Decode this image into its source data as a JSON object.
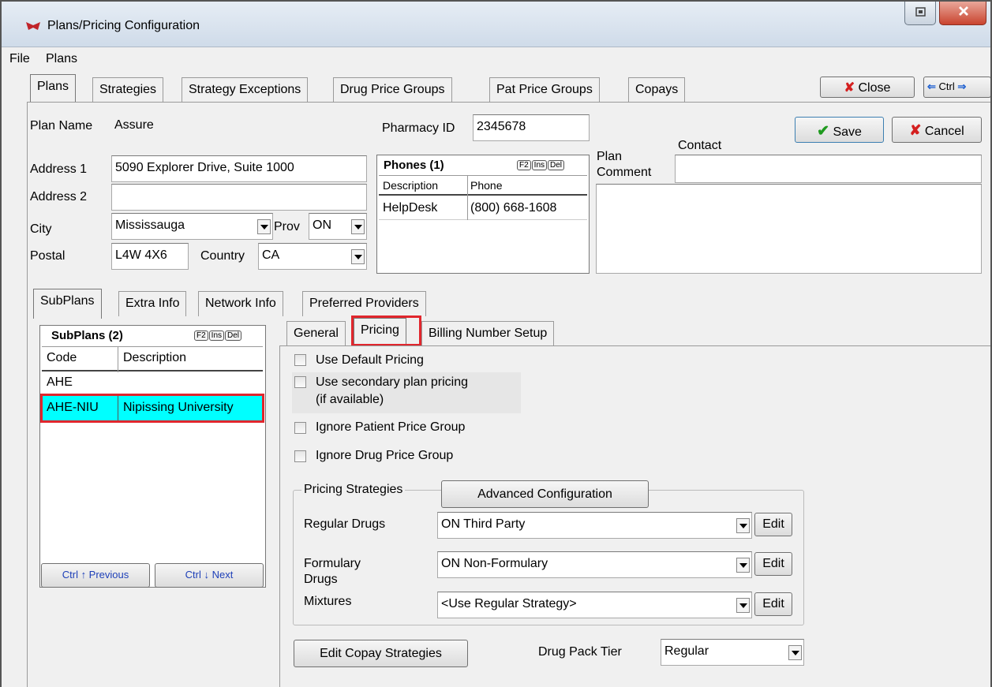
{
  "window": {
    "title": "Plans/Pricing Configuration"
  },
  "menu": [
    "File",
    "Plans"
  ],
  "main_tabs": [
    "Plans",
    "Strategies",
    "Strategy Exceptions",
    "Drug Price Groups",
    "Pat Price Groups",
    "Copays"
  ],
  "toolbar": {
    "close_label": "Close",
    "ctrl_label": "Ctrl"
  },
  "actions": {
    "save_label": "Save",
    "cancel_label": "Cancel"
  },
  "plan": {
    "name_label": "Plan Name",
    "name": "Assure",
    "pharmacy_id_label": "Pharmacy ID",
    "pharmacy_id": "2345678",
    "address1_label": "Address 1",
    "address1": "5090 Explorer Drive, Suite 1000",
    "address2_label": "Address 2",
    "address2": "",
    "city_label": "City",
    "city": "Mississauga",
    "prov_label": "Prov",
    "prov": "ON",
    "postal_label": "Postal",
    "postal": "L4W 4X6",
    "country_label": "Country",
    "country": "CA",
    "comment_label_1": "Plan",
    "comment_label_2": "Comment",
    "contact_label": "Contact",
    "contact": ""
  },
  "phones": {
    "title": "Phones (1)",
    "keys": [
      "F2",
      "Ins",
      "Del"
    ],
    "headers": [
      "Description",
      "Phone"
    ],
    "rows": [
      {
        "description": "HelpDesk",
        "phone": "(800) 668-1608"
      }
    ]
  },
  "sub_tabs": [
    "SubPlans",
    "Extra Info",
    "Network Info",
    "Preferred Providers"
  ],
  "subplans": {
    "title": "SubPlans (2)",
    "keys": [
      "F2",
      "Ins",
      "Del"
    ],
    "headers": [
      "Code",
      "Description"
    ],
    "rows": [
      {
        "code": "AHE",
        "description": ""
      },
      {
        "code": "AHE-NIU",
        "description": "Nipissing University"
      }
    ],
    "prev_label": "Ctrl ↑ Previous",
    "next_label": "Ctrl ↓ Next"
  },
  "pricing_tabs": [
    "General",
    "Pricing",
    "Billing Number Setup"
  ],
  "pricing": {
    "use_default": "Use Default Pricing",
    "use_secondary_1": "Use secondary plan pricing",
    "use_secondary_2": "(if available)",
    "ignore_patient": "Ignore Patient Price Group",
    "ignore_drug": "Ignore Drug Price Group",
    "strategies_title": "Pricing Strategies",
    "advanced_label": "Advanced Configuration",
    "regular_label": "Regular Drugs",
    "regular_value": "ON Third Party",
    "formulary_label_1": "Formulary",
    "formulary_label_2": "Drugs",
    "formulary_value": "ON Non-Formulary",
    "mixtures_label": "Mixtures",
    "mixtures_value": "<Use Regular Strategy>",
    "edit_label": "Edit",
    "copay_label": "Edit Copay Strategies",
    "tier_label": "Drug Pack Tier",
    "tier_value": "Regular"
  },
  "colors": {
    "selection": "#00ffff",
    "highlight": "#e1262d"
  }
}
